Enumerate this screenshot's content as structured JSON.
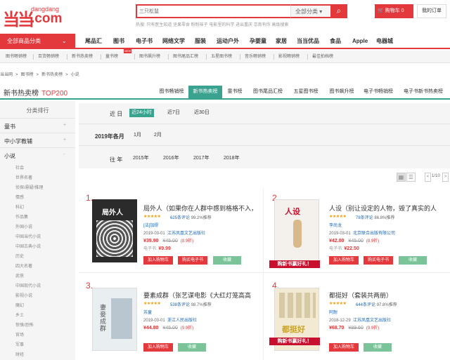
{
  "logo": {
    "sub": "dangdang",
    "main": ".com",
    "mark": "当当"
  },
  "search": {
    "value": "三只松鼠",
    "category": "全部分类",
    "hot": "热搜: 只有医生知道   坚果零食   粉粉袜子   电影里的科学   进出重庆   京南有你  高级搜索"
  },
  "cart": {
    "label": "购物车 0"
  },
  "my_orders": "我的订单",
  "nav": {
    "all_categories": "全部商品分类",
    "items": [
      "尾品汇",
      "图书",
      "电子书",
      "网络文学",
      "服装",
      "运动户外",
      "孕婴童",
      "家居",
      "当当优品",
      "食品",
      "Apple",
      "电器城"
    ]
  },
  "subnav": [
    "图书畅销榜",
    "百货畅销榜",
    "新书热卖榜",
    "童书榜",
    "图书飙升榜",
    "图书尾品汇榜",
    "五星图书榜",
    "音乐畅销榜",
    "影视畅销榜",
    "最佳拍档榜"
  ],
  "subnav_badge": "NEW",
  "breadcrumb": [
    "当当网",
    ">",
    "图书榜",
    ">",
    "新书热卖榜",
    ">",
    "小说"
  ],
  "section": {
    "title": "新书热卖榜",
    "top": "TOP200"
  },
  "tabs": [
    "图书畅销榜",
    "新书热卖榜",
    "童书榜",
    "图书尾品汇榜",
    "五星图书榜",
    "图书飙升榜",
    "电子书畅销榜",
    "电子书新书热卖榜"
  ],
  "sidebar": {
    "heading": "分类排行",
    "categories": [
      {
        "label": "童书",
        "plus": "+"
      },
      {
        "label": "中小学教辅",
        "plus": "+"
      },
      {
        "label": "小说",
        "plus": "-"
      }
    ],
    "subcategories": [
      "社会",
      "世界名著",
      "侦探/悬疑/推理",
      "情感",
      "科幻",
      "作品集",
      "外国小说",
      "中国当代小说",
      "中国古典小说",
      "历史",
      "四大名著",
      "武侠",
      "中国现代小说",
      "影视小说",
      "魔幻",
      "乡土",
      "惊悚/恐怖",
      "官场",
      "军事",
      "财经"
    ]
  },
  "filter": {
    "rows": [
      {
        "label": "近 日",
        "options": [
          "近24小时",
          "近7日",
          "近30日"
        ],
        "selected": 0
      },
      {
        "label": "2019年各月",
        "options": [
          "1月",
          "2月"
        ],
        "selected": -1
      },
      {
        "label": "往 年",
        "options": [
          "2015年",
          "2016年",
          "2017年",
          "2018年"
        ],
        "selected": -1
      }
    ]
  },
  "pagination": {
    "info": "1/10",
    "prev": "<",
    "next": ">",
    "grid": "▦",
    "list": "☰"
  },
  "books": [
    {
      "rank": "1.",
      "title": "局外人（如果你在人群中感到格格不入，",
      "stars": "★★★★★",
      "reviews": "625条评论",
      "recommend": "99.2%推荐",
      "author": "[法]加缪",
      "date": "2019-03-01",
      "publisher": "江苏凤凰文艺出版社",
      "price": "¥39.90",
      "orig": "¥45.00",
      "disc": "(8.9折)",
      "ebook_label": "电子书:",
      "ebook_price": "¥9.99",
      "btn_cart": "加入购物车",
      "btn_ebook": "购买电子书",
      "btn_fav": "收藏",
      "cover_text": "局外人",
      "banner": ""
    },
    {
      "rank": "2.",
      "title": "人设（别让设定的人物，毁了真实的人",
      "stars": "★★★★★",
      "reviews": "78条评论",
      "recommend": "86.8%推荐",
      "author": "李尚龙",
      "date": "2019-03-01",
      "publisher": "北京联合出版有限公司",
      "price": "¥42.00",
      "orig": "¥45.00",
      "disc": "(8.9折)",
      "ebook_label": "电子书:",
      "ebook_price": "¥22.50",
      "btn_cart": "加入购物车",
      "btn_ebook": "购买电子书",
      "btn_fav": "收藏",
      "cover_text": "人设",
      "banner": "购新书赢好礼！"
    },
    {
      "rank": "3.",
      "title": "要素成群（张艺谋电影《大红灯笼高高",
      "stars": "★★★★★",
      "reviews": "538条评论",
      "recommend": "98.7%推荐",
      "author": "苏童",
      "date": "2019-03-01",
      "publisher": "浙江人民出版社",
      "price": "¥44.80",
      "orig": "¥45.00",
      "disc": "(9.9折)",
      "ebook_label": "",
      "ebook_price": "",
      "btn_cart": "加入购物车",
      "btn_ebook": "",
      "btn_fav": "收藏",
      "cover_text": "妻妾成群",
      "banner": ""
    },
    {
      "rank": "4.",
      "title": "都挺好（套装共两册）",
      "stars": "★★★★★",
      "reviews": "644条评论",
      "recommend": "97.8%推荐",
      "author": "阿耐",
      "date": "2018-12-29",
      "publisher": "江苏凤凰文艺出版社",
      "price": "¥68.70",
      "orig": "¥89.60",
      "disc": "(9.9折)",
      "ebook_label": "",
      "ebook_price": "",
      "btn_cart": "加入购物车",
      "btn_ebook": "",
      "btn_fav": "收藏",
      "cover_text": "都挺好",
      "banner": "购新书赢好礼！"
    }
  ],
  "colors": {
    "brand": "#e4393c",
    "accent": "#3aa38f",
    "fav": "#7bc49a"
  }
}
